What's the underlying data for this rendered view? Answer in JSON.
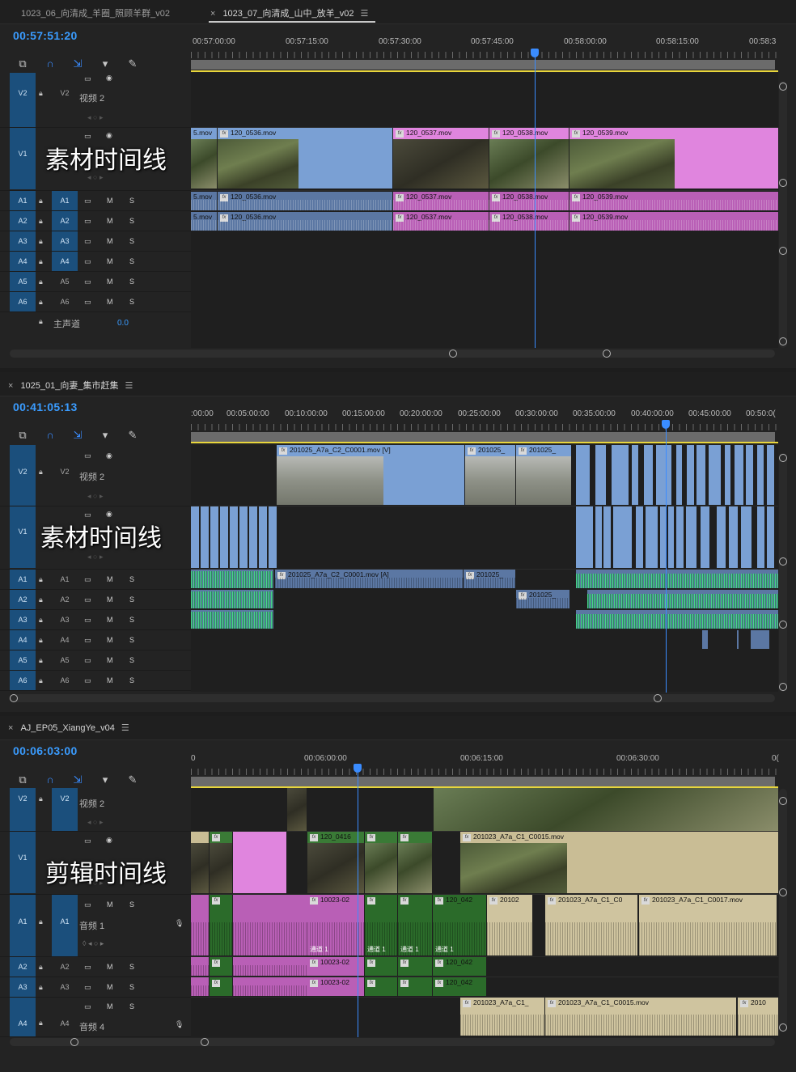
{
  "panel1": {
    "tabs": [
      {
        "label": "1023_06_向清成_羊圈_照顾羊群_v02",
        "active": false
      },
      {
        "label": "1023_07_向清成_山中_放羊_v02",
        "active": true
      }
    ],
    "timecode": "00:57:51:20",
    "ruler": [
      "00:57:00:00",
      "00:57:15:00",
      "00:57:30:00",
      "00:57:45:00",
      "00:58:00:00",
      "00:58:15:00",
      "00:58:3"
    ],
    "overlay": "素材时间线",
    "video_tracks": [
      {
        "id": "V2",
        "name": "视频 2"
      },
      {
        "id": "V1",
        "name": ""
      }
    ],
    "audio_tracks": [
      "A1",
      "A2",
      "A3",
      "A4",
      "A5",
      "A6"
    ],
    "master": {
      "label": "主声道",
      "value": "0.0"
    },
    "clips_v1": [
      "5.mov",
      "120_0536.mov",
      "120_0537.mov",
      "120_0538.mov",
      "120_0539.mov"
    ],
    "clips_a": [
      "5.mov",
      "120_0536.mov",
      "120_0537.mov",
      "120_0538.mov",
      "120_0539.mov"
    ]
  },
  "panel2": {
    "tab": "1025_01_向妻_集市赶集",
    "timecode": "00:41:05:13",
    "ruler": [
      ":00:00",
      "00:05:00:00",
      "00:10:00:00",
      "00:15:00:00",
      "00:20:00:00",
      "00:25:00:00",
      "00:30:00:00",
      "00:35:00:00",
      "00:40:00:00",
      "00:45:00:00",
      "00:50:0("
    ],
    "overlay": "素材时间线",
    "video_tracks": [
      {
        "id": "V2",
        "name": "视频 2"
      },
      {
        "id": "V1",
        "name": ""
      }
    ],
    "audio_tracks": [
      "A1",
      "A2",
      "A3",
      "A4",
      "A5",
      "A6"
    ],
    "clips_v2": [
      "201025_A7a_C2_C0001.mov [V]",
      "201025_",
      "201025_"
    ],
    "clips_a1": [
      "201025_A7a_C2_C0001.mov [A]",
      "201025_"
    ],
    "clips_a2": [
      "201025_"
    ]
  },
  "panel3": {
    "tab": "AJ_EP05_XiangYe_v04",
    "timecode": "00:06:03:00",
    "ruler": [
      "0",
      "00:06:00:00",
      "00:06:15:00",
      "00:06:30:00",
      "0("
    ],
    "overlay": "剪辑时间线",
    "video_tracks": [
      {
        "id": "V2",
        "name": "视频 2"
      },
      {
        "id": "V1",
        "name": ""
      }
    ],
    "audio_tracks": [
      {
        "id": "A1",
        "name": "音频 1"
      },
      {
        "id": "A2",
        "name": ""
      },
      {
        "id": "A3",
        "name": ""
      },
      {
        "id": "A4",
        "name": "音频 4"
      }
    ],
    "clips_v1": [
      "120_0416",
      "201023_A7a_C1_C0015.mov"
    ],
    "clips_a1": [
      "10023-02",
      "120_042",
      "20102",
      "201023_A7a_C1_C0",
      "201023_A7a_C1_C0017.mov"
    ],
    "channel_labels": [
      "通道 1",
      "通道 1",
      "通道 1",
      "通道 1"
    ],
    "clips_a2": [
      "10023-02",
      "120_042"
    ],
    "clips_a3": [
      "10023-02",
      "120_042"
    ],
    "clips_a4": [
      "201023_A7a_C1_",
      "201023_A7a_C1_C0015.mov",
      "2010"
    ]
  },
  "track_buttons": {
    "mute": "M",
    "solo": "S"
  },
  "icons": [
    "snap-icon",
    "link-icon",
    "marker-icon",
    "wrench-icon",
    "lock-icon",
    "eye-icon",
    "sync-icon",
    "mic-icon"
  ]
}
